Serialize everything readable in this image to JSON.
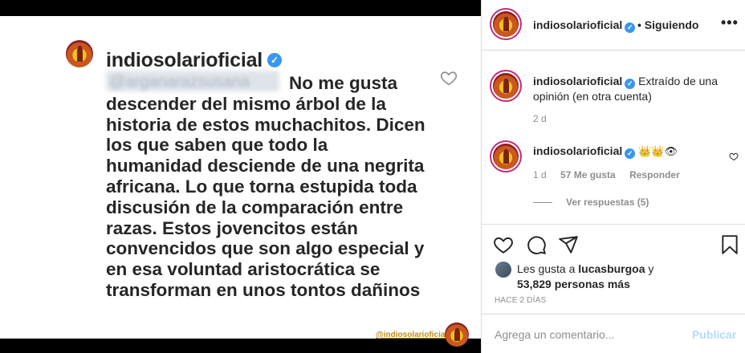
{
  "post_image": {
    "username": "indiosolarioficial",
    "blurred_mention": "@arganarazsusana",
    "comment_text": "No me gusta descender del mismo árbol de la historia de estos muchachitos. Dicen los que saben que todo la humanidad desciende de una negrita africana. Lo que torna estupida toda discusión de la comparación entre razas. Estos jovencitos están convencidos que son algo especial y en esa voluntad aristocrática se transforman en unos tontos dañinos",
    "watermark": "@indiosolarioficial"
  },
  "header": {
    "username": "indiosolarioficial",
    "follow_status": "• Siguiendo",
    "more": "•••"
  },
  "caption": {
    "username": "indiosolarioficial",
    "text": "Extraído de una opinión (en otra cuenta)",
    "time": "2 d"
  },
  "reply": {
    "username": "indiosolarioficial",
    "emoji": "👑👑👁",
    "time": "1 d",
    "likes": "57 Me gusta",
    "reply_label": "Responder",
    "view_replies": "Ver respuestas (5)"
  },
  "likes": {
    "prefix": "Les gusta a",
    "user": "lucasburgoa",
    "suffix": "y",
    "count": "53,829 personas más"
  },
  "post_age": "HACE 2 DÍAS",
  "comment_box": {
    "placeholder": "Agrega un comentario...",
    "publish_label": "Publicar"
  },
  "colors": {
    "verified": "#3897f0",
    "publish_disabled": "#b3dbff",
    "muted": "#8e8e8e"
  }
}
